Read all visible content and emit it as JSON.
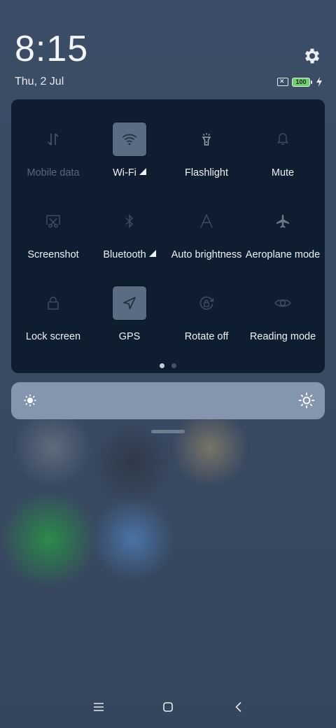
{
  "status_bar": {
    "time": "8:15",
    "date": "Thu, 2 Jul",
    "battery_level": "100",
    "icons": [
      "settings-icon",
      "no-sim-icon",
      "battery-icon",
      "charging-bolt-icon"
    ]
  },
  "quick_settings": {
    "tiles": [
      {
        "label": "Mobile data",
        "icon": "mobile-data-icon",
        "state": "disabled"
      },
      {
        "label": "Wi-Fi",
        "icon": "wifi-icon",
        "state": "on",
        "expand": true
      },
      {
        "label": "Flashlight",
        "icon": "flashlight-icon",
        "state": "off"
      },
      {
        "label": "Mute",
        "icon": "bell-icon",
        "state": "off"
      },
      {
        "label": "Screenshot",
        "icon": "screenshot-icon",
        "state": "off"
      },
      {
        "label": "Bluetooth",
        "icon": "bluetooth-icon",
        "state": "off",
        "expand": true
      },
      {
        "label": "Auto brightness",
        "icon": "auto-brightness-icon",
        "state": "off"
      },
      {
        "label": "Aeroplane mode",
        "icon": "airplane-icon",
        "state": "off"
      },
      {
        "label": "Lock screen",
        "icon": "lock-icon",
        "state": "off"
      },
      {
        "label": "GPS",
        "icon": "location-arrow-icon",
        "state": "on"
      },
      {
        "label": "Rotate off",
        "icon": "rotation-lock-icon",
        "state": "off"
      },
      {
        "label": "Reading mode",
        "icon": "eye-icon",
        "state": "off"
      }
    ],
    "page_count": 2,
    "current_page": 1
  },
  "brightness": {
    "icons": [
      "brightness-low-icon",
      "brightness-high-icon"
    ]
  },
  "navigation": {
    "buttons": [
      "menu-icon",
      "home-icon",
      "back-icon"
    ]
  },
  "colors": {
    "panel_bg": "#0e1e30",
    "active_tile": "#5b6c82",
    "brightness_bar": "#8495ad",
    "battery_fill": "#6bd36a"
  }
}
